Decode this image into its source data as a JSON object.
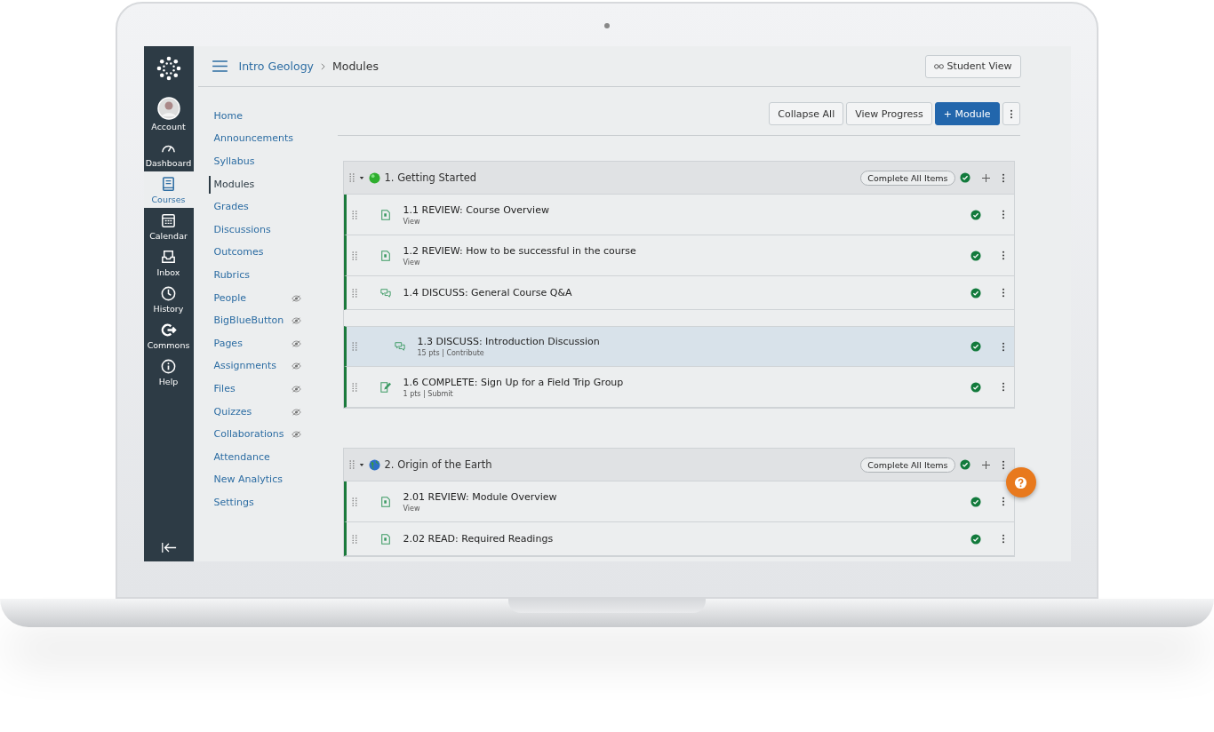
{
  "global_nav": [
    {
      "label": "Account",
      "kind": "account",
      "selected": false
    },
    {
      "label": "Dashboard",
      "kind": "dashboard",
      "selected": false
    },
    {
      "label": "Courses",
      "kind": "courses",
      "selected": true
    },
    {
      "label": "Calendar",
      "kind": "calendar",
      "selected": false
    },
    {
      "label": "Inbox",
      "kind": "inbox",
      "selected": false
    },
    {
      "label": "History",
      "kind": "history",
      "selected": false
    },
    {
      "label": "Commons",
      "kind": "commons",
      "selected": false
    },
    {
      "label": "Help",
      "kind": "help",
      "selected": false
    }
  ],
  "breadcrumb": [
    "Intro Geology",
    "Modules"
  ],
  "student_view_button": "Student View",
  "course_nav": [
    {
      "label": "Home",
      "selected": false,
      "hidden": false
    },
    {
      "label": "Announcements",
      "selected": false,
      "hidden": false
    },
    {
      "label": "Syllabus",
      "selected": false,
      "hidden": false
    },
    {
      "label": "Modules",
      "selected": true,
      "hidden": false
    },
    {
      "label": "Grades",
      "selected": false,
      "hidden": false
    },
    {
      "label": "Discussions",
      "selected": false,
      "hidden": false
    },
    {
      "label": "Outcomes",
      "selected": false,
      "hidden": false
    },
    {
      "label": "Rubrics",
      "selected": false,
      "hidden": false
    },
    {
      "label": "People",
      "selected": false,
      "hidden": true
    },
    {
      "label": "BigBlueButton",
      "selected": false,
      "hidden": true
    },
    {
      "label": "Pages",
      "selected": false,
      "hidden": true
    },
    {
      "label": "Assignments",
      "selected": false,
      "hidden": true
    },
    {
      "label": "Files",
      "selected": false,
      "hidden": true
    },
    {
      "label": "Quizzes",
      "selected": false,
      "hidden": true
    },
    {
      "label": "Collaborations",
      "selected": false,
      "hidden": true
    },
    {
      "label": "Attendance",
      "selected": false,
      "hidden": false
    },
    {
      "label": "New Analytics",
      "selected": false,
      "hidden": false
    },
    {
      "label": "Settings",
      "selected": false,
      "hidden": false
    }
  ],
  "toolbar": {
    "collapse_all": "Collapse All",
    "view_progress": "View Progress",
    "add_module": "+ Module"
  },
  "modules": [
    {
      "title": "1. Getting Started",
      "kind": "dot",
      "complete_all": "Complete All Items",
      "published": true,
      "items": [
        {
          "title": "1.1 REVIEW: Course Overview",
          "meta": "View",
          "kind": "page",
          "published": true,
          "selected": false
        },
        {
          "title": "1.2 REVIEW: How to be successful in the course",
          "meta": "View",
          "kind": "page",
          "published": true,
          "selected": false
        },
        {
          "title": "1.4 DISCUSS: General Course Q&A",
          "kind": "discussion",
          "published": true,
          "selected": false
        },
        {
          "title": "1.3 DISCUSS: Introduction Discussion",
          "meta": "15 pts | Contribute",
          "kind": "discussion",
          "published": true,
          "selected": true
        },
        {
          "title": "1.6 COMPLETE: Sign Up for a Field Trip Group",
          "meta": "1 pts | Submit",
          "kind": "assignment",
          "published": true,
          "selected": false
        }
      ]
    },
    {
      "title": "2. Origin of the Earth",
      "kind": "globe",
      "complete_all": "Complete All Items",
      "published": true,
      "items": [
        {
          "title": "2.01 REVIEW: Module Overview",
          "meta": "View",
          "kind": "page",
          "published": true,
          "selected": false
        },
        {
          "title": "2.02 READ: Required Readings",
          "kind": "page",
          "published": true,
          "selected": false
        }
      ]
    }
  ]
}
